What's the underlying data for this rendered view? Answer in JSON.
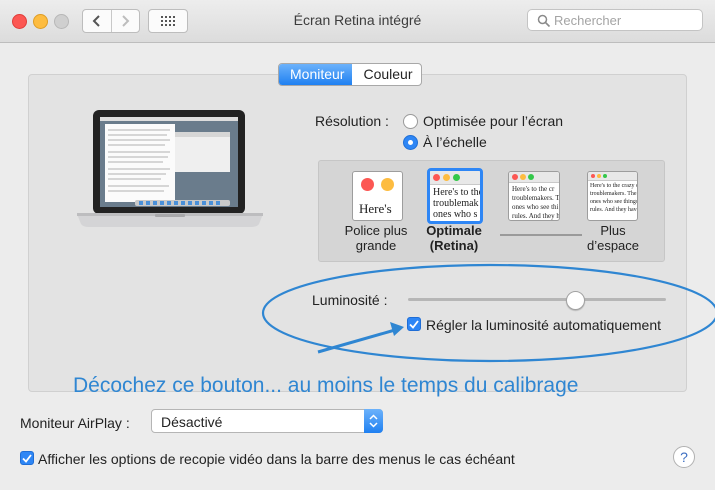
{
  "window": {
    "title": "Écran Retina intégré"
  },
  "search": {
    "placeholder": "Rechercher"
  },
  "tabs": [
    {
      "label": "Moniteur",
      "active": true
    },
    {
      "label": "Couleur",
      "active": false
    }
  ],
  "resolution": {
    "label": "Résolution :",
    "options": [
      {
        "label": "Optimisée pour l’écran",
        "selected": false
      },
      {
        "label": "À l’échelle",
        "selected": true
      }
    ],
    "scales": [
      {
        "caption_line1": "Police plus",
        "caption_line2": "grande",
        "sample": "Here's",
        "selected": false
      },
      {
        "caption_line1": "Optimale",
        "caption_line2": "(Retina)",
        "sample": "Here's to the\ntroublemak\nones who s",
        "selected": true
      },
      {
        "caption_line1": "",
        "caption_line2": "",
        "sample": "Here's to the cr\ntroublemakers. T\nones who see thi\nrules. And they h",
        "selected": false
      },
      {
        "caption_line1": "Plus",
        "caption_line2": "d’espace",
        "sample": "Here's to the crazy one\ntroublemakers. The rou\nones who see things dif\nrules. And they have no",
        "selected": false
      }
    ]
  },
  "brightness": {
    "label": "Luminosité :",
    "level_percent": 62,
    "auto_label": "Régler la luminosité automatiquement",
    "auto_checked": true
  },
  "annotation": {
    "text": "Décochez ce bouton... au moins le temps du calibrage",
    "color": "#2f86d2"
  },
  "airplay": {
    "label": "Moniteur AirPlay :",
    "value": "Désactivé"
  },
  "mirroring": {
    "label": "Afficher les options de recopie vidéo dans la barre des menus le cas échéant",
    "checked": true
  },
  "colors": {
    "accent": "#2e86f5",
    "close": "#fc5753",
    "minimize": "#fdbc40"
  }
}
